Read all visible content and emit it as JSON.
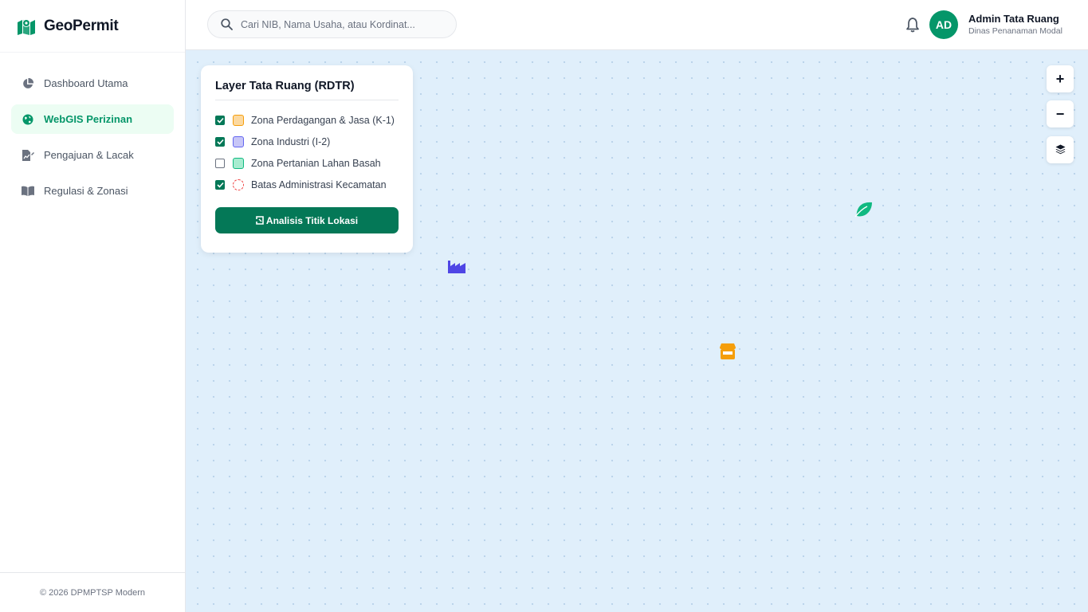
{
  "brand": {
    "name": "GeoPermit",
    "color": "#059669"
  },
  "sidebar": {
    "items": [
      {
        "label": "Dashboard Utama",
        "icon": "pie-chart-icon",
        "active": false
      },
      {
        "label": "WebGIS Perizinan",
        "icon": "globe-icon",
        "active": true
      },
      {
        "label": "Pengajuan & Lacak",
        "icon": "file-chart-icon",
        "active": false
      },
      {
        "label": "Regulasi & Zonasi",
        "icon": "book-icon",
        "active": false
      }
    ],
    "footer": "© 2026 DPMPTSP Modern"
  },
  "header": {
    "search": {
      "placeholder": "Cari NIB, Nama Usaha, atau Kordinat..."
    },
    "notification_icon": "bell-icon",
    "user": {
      "initials": "AD",
      "name": "Admin Tata Ruang",
      "role": "Dinas Penanaman Modal"
    }
  },
  "layer_panel": {
    "title": "Layer Tata Ruang (RDTR)",
    "layers": [
      {
        "label": "Zona Perdagangan & Jasa (K-1)",
        "checked": true,
        "color": "#fbbf24"
      },
      {
        "label": "Zona Industri (I-2)",
        "checked": true,
        "color": "#6366f1"
      },
      {
        "label": "Zona Pertanian Lahan Basah",
        "checked": false,
        "color": "#10b981"
      },
      {
        "label": "Batas Administrasi Kecamatan",
        "checked": true,
        "color": "#ef4444"
      }
    ],
    "analyze_button": "Analisis Titik Lokasi"
  },
  "map_controls": {
    "zoom_in": "+",
    "zoom_out": "−",
    "layers_icon": "layers-icon"
  },
  "markers": [
    {
      "type": "industry",
      "icon": "factory-icon",
      "color": "#4f46e5"
    },
    {
      "type": "agriculture",
      "icon": "leaf-icon",
      "color": "#10b981"
    },
    {
      "type": "commerce",
      "icon": "store-icon",
      "color": "#f59e0b"
    }
  ]
}
